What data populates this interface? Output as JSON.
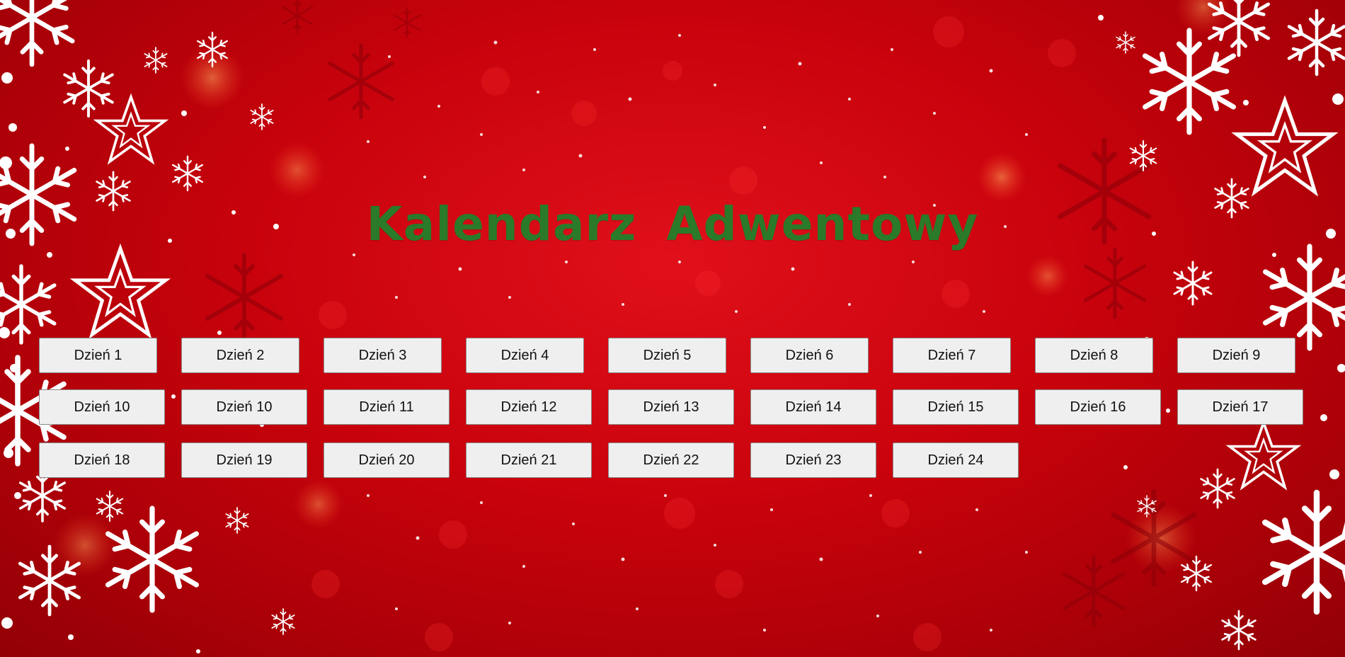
{
  "title": "Kalendarz Adwentowy",
  "colors": {
    "background": "#c8020c",
    "title": "#2a7a2a",
    "button_bg": "#efefef",
    "snow": "#ffffff"
  },
  "days": {
    "row1": [
      "Dzień 1",
      "Dzień 2",
      "Dzień 3",
      "Dzień 4",
      "Dzień 5",
      "Dzień 6",
      "Dzień 7",
      "Dzień 8",
      "Dzień 9"
    ],
    "row2": [
      "Dzień 10",
      "Dzień 10",
      "Dzień 11",
      "Dzień 12",
      "Dzień 13",
      "Dzień 14",
      "Dzień 15",
      "Dzień 16",
      "Dzień 17"
    ],
    "row3": [
      "Dzień 18",
      "Dzień 19",
      "Dzień 20",
      "Dzień 21",
      "Dzień 22",
      "Dzień 23",
      "Dzień 24"
    ]
  }
}
